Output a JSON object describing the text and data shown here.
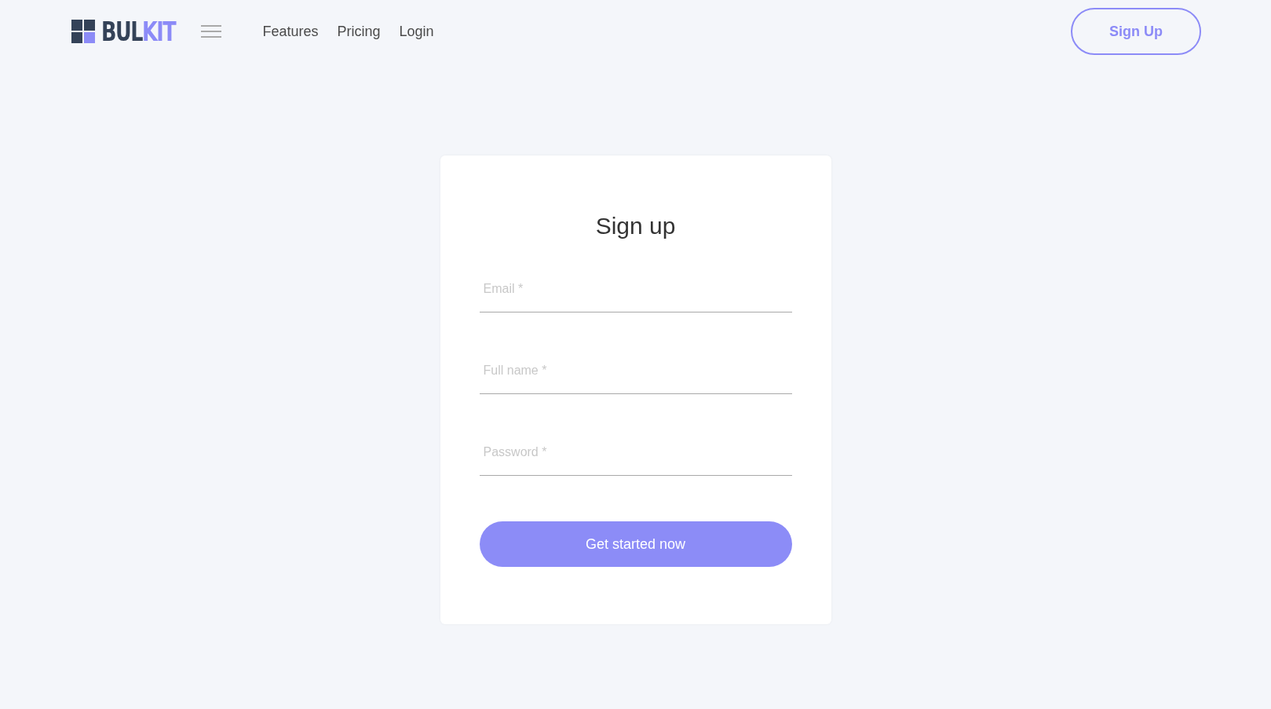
{
  "logo": {
    "text_dark": "BUL",
    "text_accent": "KIT"
  },
  "nav": [
    {
      "label": "Features"
    },
    {
      "label": "Pricing"
    },
    {
      "label": "Login"
    }
  ],
  "signup_button": {
    "label": "Sign Up"
  },
  "card": {
    "title": "Sign up",
    "fields": [
      {
        "placeholder": "Email *"
      },
      {
        "placeholder": "Full name *"
      },
      {
        "placeholder": "Password *"
      }
    ],
    "submit": {
      "label": "Get started now"
    }
  }
}
